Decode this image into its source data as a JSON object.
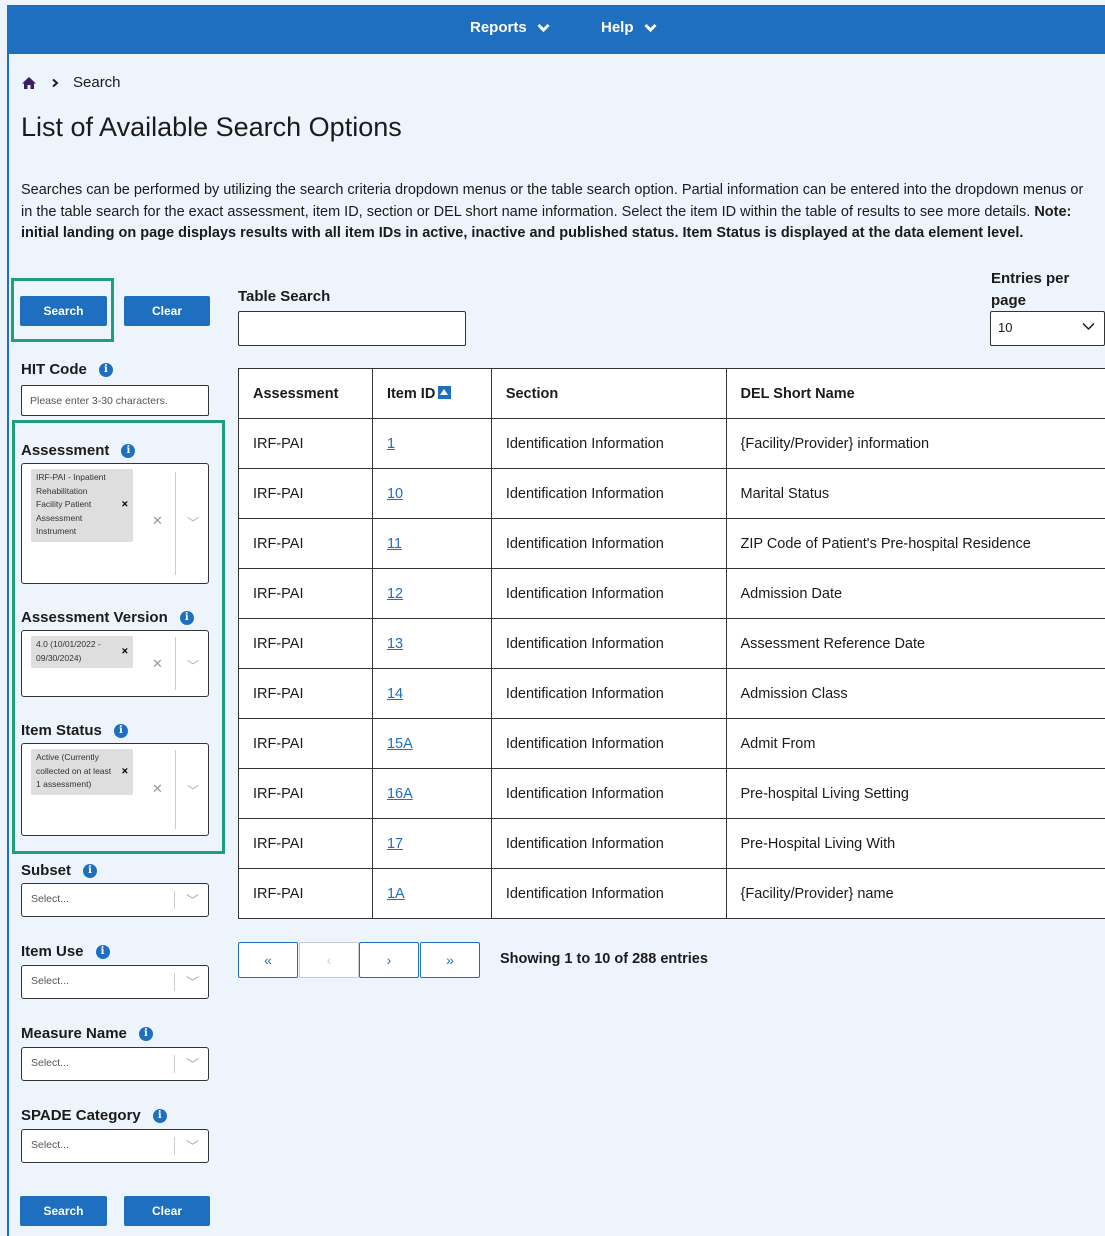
{
  "nav": {
    "reports": "Reports",
    "help": "Help"
  },
  "breadcrumb": {
    "current": "Search"
  },
  "page": {
    "title": "List of Available Search Options",
    "intro_text": "Searches can be performed by utilizing the search criteria dropdown menus or the table search option. Partial information can be entered into the dropdown menus or in the table search for the exact assessment, item ID, section or DEL short name information. Select the item ID within the table of results to see more details. ",
    "intro_note": "Note: initial landing on page displays results with all item IDs in active, inactive and published status. Item Status is displayed at the data element level."
  },
  "filters": {
    "search_label": "Search",
    "clear_label": "Clear",
    "hit_code": {
      "label": "HIT Code",
      "placeholder": "Please enter 3-30 characters."
    },
    "assessment": {
      "label": "Assessment",
      "selected": "IRF-PAI - Inpatient Rehabilitation Facility Patient Assessment Instrument"
    },
    "assessment_version": {
      "label": "Assessment Version",
      "selected": "4.0 (10/01/2022 - 09/30/2024)"
    },
    "item_status": {
      "label": "Item Status",
      "selected": "Active (Currently collected on at least 1 assessment)"
    },
    "subset": {
      "label": "Subset",
      "placeholder": "Select..."
    },
    "item_use": {
      "label": "Item Use",
      "placeholder": "Select..."
    },
    "measure_name": {
      "label": "Measure Name",
      "placeholder": "Select..."
    },
    "spade_category": {
      "label": "SPADE Category",
      "placeholder": "Select..."
    }
  },
  "table_search": {
    "label": "Table Search",
    "value": ""
  },
  "entries": {
    "label": "Entries per page",
    "value": "10"
  },
  "table": {
    "headers": [
      "Assessment",
      "Item ID",
      "Section",
      "DEL Short Name"
    ],
    "rows": [
      [
        "IRF-PAI",
        "1",
        "Identification Information",
        "{Facility/Provider} information"
      ],
      [
        "IRF-PAI",
        "10",
        "Identification Information",
        "Marital Status"
      ],
      [
        "IRF-PAI",
        "11",
        "Identification Information",
        "ZIP Code of Patient's Pre-hospital Residence"
      ],
      [
        "IRF-PAI",
        "12",
        "Identification Information",
        "Admission Date"
      ],
      [
        "IRF-PAI",
        "13",
        "Identification Information",
        "Assessment Reference Date"
      ],
      [
        "IRF-PAI",
        "14",
        "Identification Information",
        "Admission Class"
      ],
      [
        "IRF-PAI",
        "15A",
        "Identification Information",
        "Admit From"
      ],
      [
        "IRF-PAI",
        "16A",
        "Identification Information",
        "Pre-hospital Living Setting"
      ],
      [
        "IRF-PAI",
        "17",
        "Identification Information",
        "Pre-Hospital Living With"
      ],
      [
        "IRF-PAI",
        "1A",
        "Identification Information",
        "{Facility/Provider} name"
      ]
    ]
  },
  "pagination": {
    "first": "«",
    "prev": "‹",
    "next": "›",
    "last": "»",
    "showing": "Showing 1 to 10 of 288 entries"
  },
  "colors": {
    "accent": "#1e6fbf",
    "highlight": "#1f9e7f",
    "background": "#eef4fc"
  }
}
